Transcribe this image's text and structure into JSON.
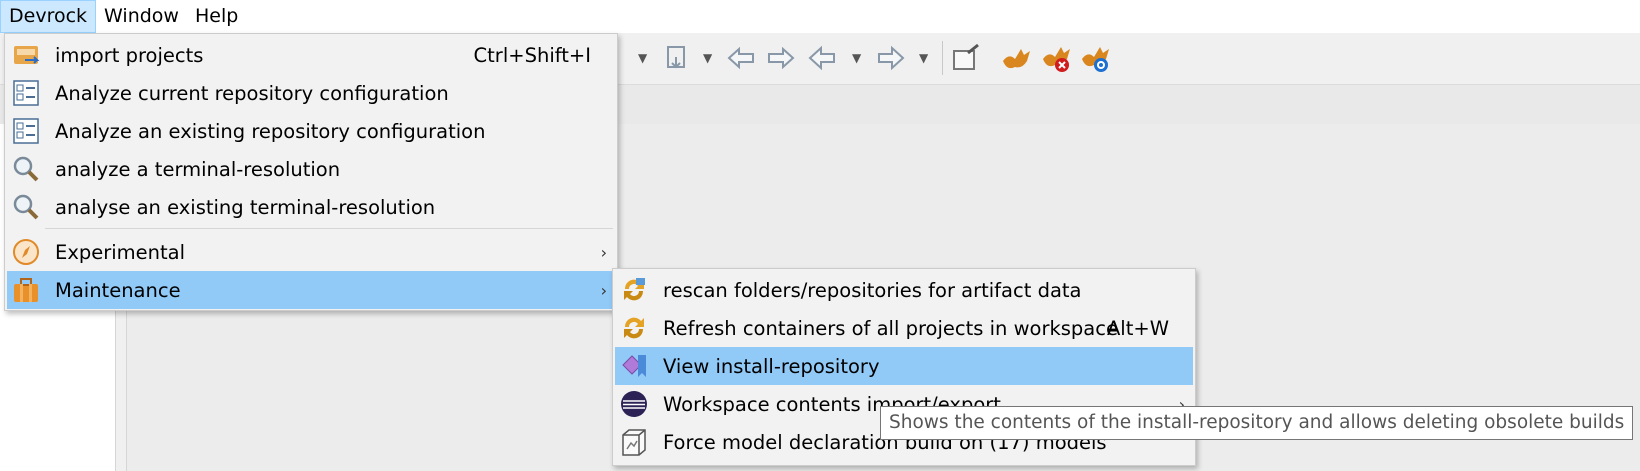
{
  "menubar": {
    "items": [
      "Devrock",
      "Window",
      "Help"
    ]
  },
  "devrock_menu": {
    "items": [
      {
        "label": "import projects",
        "accel": "Ctrl+Shift+I",
        "icon": "import-projects-icon"
      },
      {
        "label": "Analyze current repository configuration",
        "icon": "config-list-icon"
      },
      {
        "label": "Analyze an existing repository configuration",
        "icon": "config-list-icon"
      },
      {
        "label": "analyze a terminal-resolution",
        "icon": "magnifier-icon"
      },
      {
        "label": "analyse an existing terminal-resolution",
        "icon": "magnifier-icon"
      },
      {
        "label": "Experimental",
        "icon": "compass-icon",
        "submenu": true
      },
      {
        "label": "Maintenance",
        "icon": "toolbox-icon",
        "submenu": true,
        "highlighted": true
      }
    ]
  },
  "maintenance_menu": {
    "items": [
      {
        "label": "rescan folders/repositories for artifact data",
        "icon": "rescan-icon"
      },
      {
        "label": "Refresh containers of all projects in workspace",
        "accel": "Alt+W",
        "icon": "refresh-icon"
      },
      {
        "label": "View install-repository",
        "icon": "gem-bookmark-icon",
        "highlighted": true
      },
      {
        "label": "Workspace contents import/export",
        "icon": "eclipse-icon",
        "submenu": true
      },
      {
        "label": "Force model declaration build on (17) models",
        "icon": "build-box-icon"
      }
    ]
  },
  "tooltip": {
    "text": "Shows the contents of the install-repository and allows deleting obsolete builds"
  },
  "colors": {
    "highlight": "#91c9f7",
    "menu_bg": "#f2f2f2",
    "menubar_active": "#cce8ff"
  }
}
